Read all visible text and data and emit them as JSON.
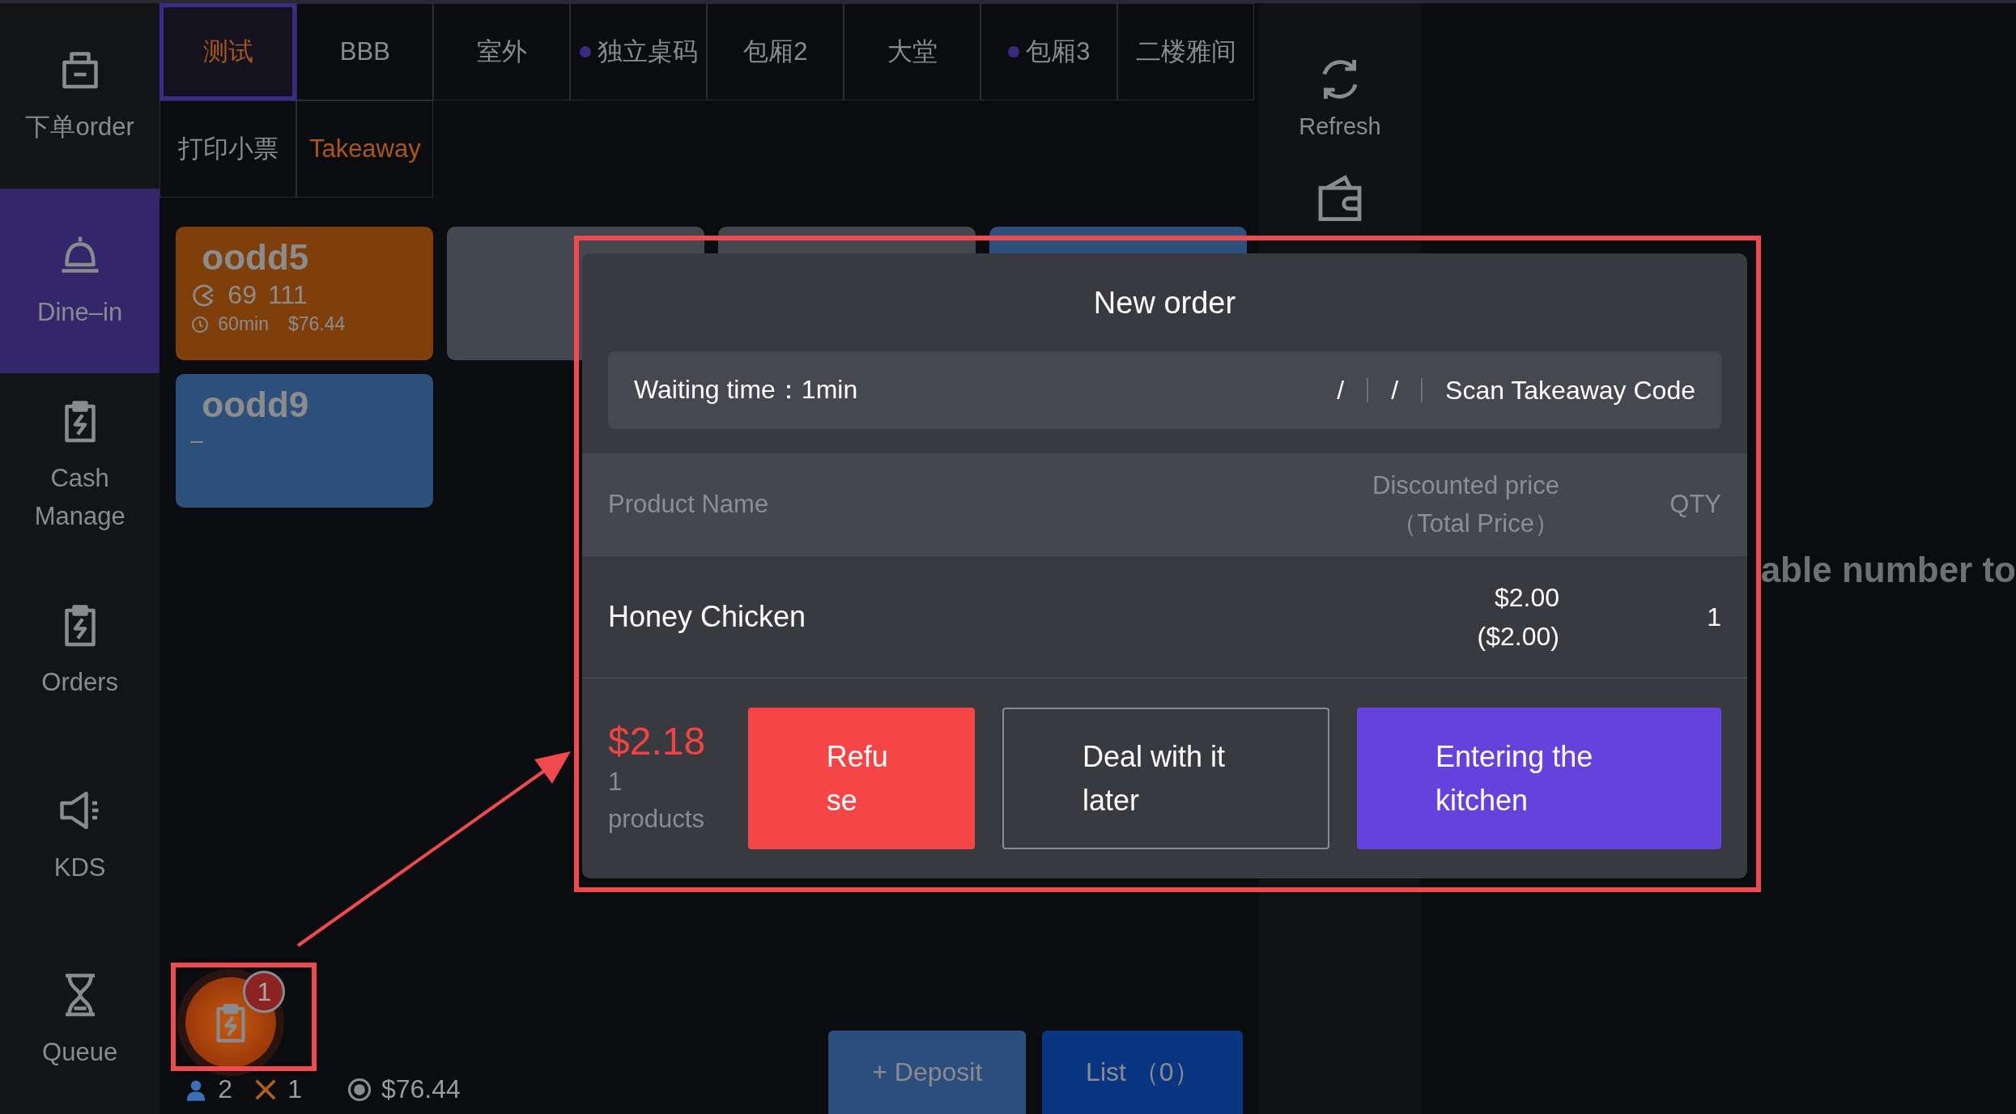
{
  "sidebar": {
    "items": [
      {
        "label": "下单order",
        "kind": "bag",
        "selected": false
      },
      {
        "label": "Dine–in",
        "kind": "bell",
        "selected": true
      },
      {
        "label": "Cash Manage",
        "kind": "clipboard",
        "selected": false
      },
      {
        "label": "Orders",
        "kind": "clipboard",
        "selected": false
      },
      {
        "label": "KDS",
        "kind": "speaker",
        "selected": false
      },
      {
        "label": "Queue",
        "kind": "hourglass",
        "selected": false
      }
    ]
  },
  "tabs": [
    {
      "label": "测试",
      "selected": true,
      "dot": false,
      "accent": true
    },
    {
      "label": "BBB",
      "selected": false,
      "dot": false,
      "accent": false
    },
    {
      "label": "室外",
      "selected": false,
      "dot": false,
      "accent": false
    },
    {
      "label": "独立桌码",
      "selected": false,
      "dot": true,
      "accent": false
    },
    {
      "label": "包厢2",
      "selected": false,
      "dot": false,
      "accent": false
    },
    {
      "label": "大堂",
      "selected": false,
      "dot": false,
      "accent": false
    },
    {
      "label": "包厢3",
      "selected": false,
      "dot": true,
      "accent": false
    },
    {
      "label": "二楼雅间",
      "selected": false,
      "dot": false,
      "accent": false
    },
    {
      "label": "打印小票",
      "selected": false,
      "dot": false,
      "accent": false
    },
    {
      "label": "Takeaway",
      "selected": false,
      "dot": false,
      "accent": true
    }
  ],
  "tables": [
    {
      "kind": "occupied",
      "name": "oodd5",
      "color": "#7f3f0a",
      "guests": "69",
      "number": "111",
      "duration": "60min",
      "amount": "$76.44"
    },
    {
      "kind": "covered",
      "color": "#434850"
    },
    {
      "kind": "covered",
      "color": "#434850"
    },
    {
      "kind": "covered",
      "color": "#2d4f7c"
    },
    {
      "kind": "idle",
      "name": "oodd9",
      "color": "#2d4f7c",
      "status": "–"
    }
  ],
  "notification": {
    "badge": "1"
  },
  "summary": {
    "guests": "2",
    "dishes": "1",
    "total": "$76.44"
  },
  "actions": [
    {
      "label": "+ Deposit",
      "kind": "deposit"
    },
    {
      "label": "List （0）",
      "kind": "list"
    }
  ],
  "tools": [
    {
      "label": "Refresh",
      "kind": "refresh"
    },
    {
      "kind": "wallet"
    }
  ],
  "content": {
    "message": "able number to"
  },
  "modal": {
    "title": "New order",
    "waiting": "Waiting time：1min",
    "fields": [
      "/",
      "/"
    ],
    "scan": "Scan Takeaway Code",
    "columns": {
      "name": "Product Name",
      "price": "Discounted price\n（Total Price）",
      "qty": "QTY"
    },
    "items": [
      {
        "name": "Honey Chicken",
        "price": "$2.00\n($2.00)",
        "qty": "1"
      }
    ],
    "total": "$2.18",
    "count": "1\nproducts",
    "buttons": [
      {
        "label": "Refuse",
        "kind": "refuse"
      },
      {
        "label": "Deal with it later",
        "kind": "later"
      },
      {
        "label": "Entering the kitchen",
        "kind": "accept"
      }
    ]
  }
}
